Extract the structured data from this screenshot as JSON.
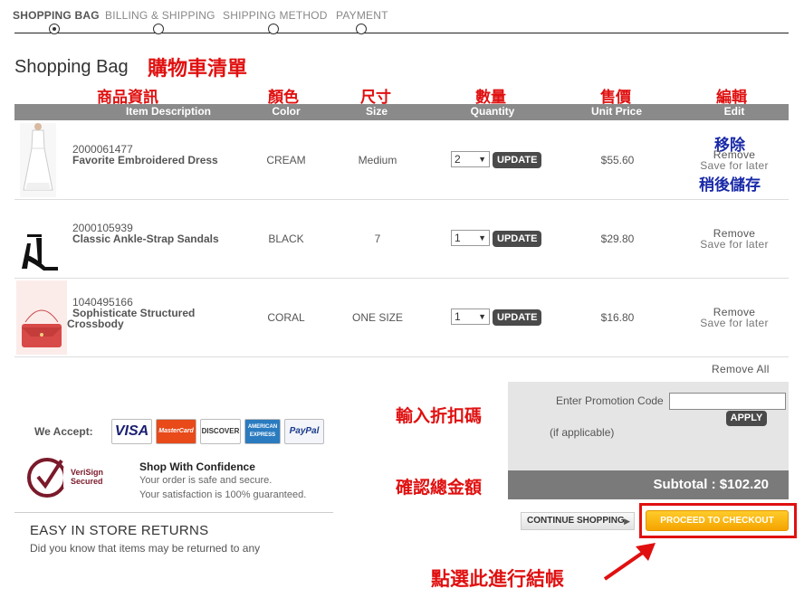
{
  "steps": [
    {
      "label": "SHOPPING BAG"
    },
    {
      "label": "BILLING & SHIPPING"
    },
    {
      "label": "SHIPPING METHOD"
    },
    {
      "label": "PAYMENT"
    }
  ],
  "page": {
    "title": "Shopping Bag",
    "title_annotation": "購物車清單"
  },
  "table": {
    "headers": [
      {
        "label": "Item Description",
        "annotation": "商品資訊"
      },
      {
        "label": "Color",
        "annotation": "顏色"
      },
      {
        "label": "Size",
        "annotation": "尺寸"
      },
      {
        "label": "Quantity",
        "annotation": "數量"
      },
      {
        "label": "Unit Price",
        "annotation": "售價"
      },
      {
        "label": "Edit",
        "annotation": "編輯"
      }
    ],
    "rows": [
      {
        "sku": "2000061477",
        "name_line1": "Favorite Embroidered Dress",
        "name_line2": "",
        "color": "CREAM",
        "size": "Medium",
        "quantity": "2",
        "update_label": "UPDATE",
        "price": "$55.60",
        "remove_label": "Remove",
        "save_label": "Save for later"
      },
      {
        "sku": "2000105939",
        "name_line1": "Classic Ankle-Strap Sandals",
        "name_line2": "",
        "color": "BLACK",
        "size": "7",
        "quantity": "1",
        "update_label": "UPDATE",
        "price": "$29.80",
        "remove_label": "Remove",
        "save_label": "Save for later"
      },
      {
        "sku": "1040495166",
        "name_line1": "Sophisticate Structured",
        "name_line2": "Crossbody",
        "color": "CORAL",
        "size": "ONE SIZE",
        "quantity": "1",
        "update_label": "UPDATE",
        "price": "$16.80",
        "remove_label": "Remove",
        "save_label": "Save for later"
      }
    ],
    "remove_annotation": "移除",
    "save_annotation": "稍後儲存",
    "remove_all_label": "Remove All"
  },
  "payment": {
    "we_accept_label": "We Accept:",
    "cards": [
      "VISA",
      "MasterCard",
      "DISCOVER",
      "AMERICAN EXPRESS",
      "PayPal"
    ]
  },
  "confidence": {
    "badge_line1": "VeriSign",
    "badge_line2": "Secured",
    "title": "Shop With Confidence",
    "line1": "Your order is safe and secure.",
    "line2": "Your satisfaction is 100% guaranteed."
  },
  "returns": {
    "title": "EASY IN STORE RETURNS",
    "text": "Did you know that items may be returned to any"
  },
  "promo": {
    "label": "Enter Promotion Code",
    "value": "",
    "apply_label": "APPLY",
    "note": "(if applicable)",
    "annotation": "輸入折扣碼"
  },
  "summary": {
    "subtotal_label": "Subtotal : $102.20",
    "annotation": "確認總金額"
  },
  "actions": {
    "continue_label": "CONTINUE SHOPPING",
    "checkout_label": "PROCEED TO CHECKOUT",
    "checkout_annotation": "點選此進行結帳"
  },
  "colors": {
    "annotation_red": "#e01010",
    "annotation_blue": "#1a2aa8",
    "header_gray": "#8a8a8a",
    "checkout_orange": "#f5a300"
  }
}
